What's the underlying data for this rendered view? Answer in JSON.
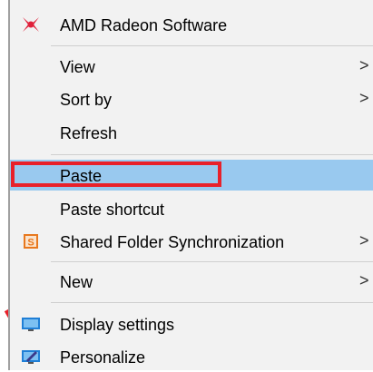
{
  "menu": {
    "items": [
      {
        "id": "amd",
        "label": "AMD Radeon Software",
        "icon": "amd-radeon-icon",
        "submenu": false
      },
      {
        "id": "view",
        "label": "View",
        "submenu": true
      },
      {
        "id": "sortby",
        "label": "Sort by",
        "submenu": true
      },
      {
        "id": "refresh",
        "label": "Refresh",
        "submenu": false
      },
      {
        "id": "paste",
        "label": "Paste",
        "submenu": false,
        "highlighted": true
      },
      {
        "id": "paste-shortcut",
        "label": "Paste shortcut",
        "submenu": false
      },
      {
        "id": "shared-folder",
        "label": "Shared Folder Synchronization",
        "icon": "shared-folder-sync-icon",
        "submenu": true
      },
      {
        "id": "new",
        "label": "New",
        "submenu": true
      },
      {
        "id": "display",
        "label": "Display settings",
        "icon": "display-settings-icon",
        "submenu": false
      },
      {
        "id": "personalize",
        "label": "Personalize",
        "icon": "personalize-icon",
        "submenu": false
      }
    ],
    "submenu_arrow": ">"
  },
  "colors": {
    "menu_background": "#f2f2f2",
    "highlight": "#99c9ef",
    "annotation_red": "#e8202a",
    "amd_red": "#e0203a",
    "shared_folder_orange": "#e8781e",
    "display_blue": "#1f7fd6"
  }
}
